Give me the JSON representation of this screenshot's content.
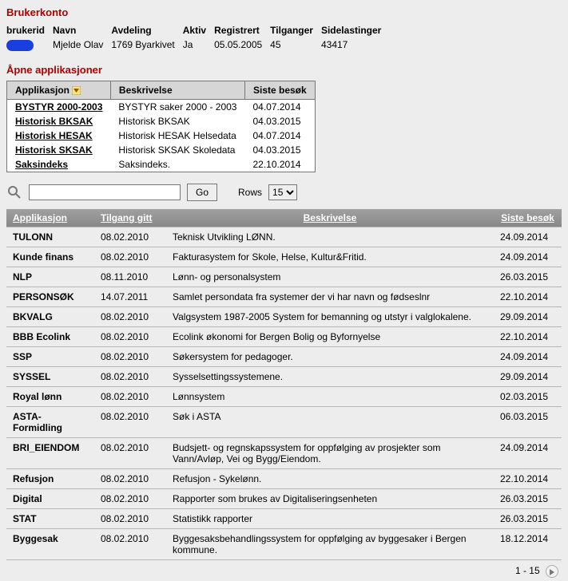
{
  "titles": {
    "user_account": "Brukerkonto",
    "open_apps": "Åpne applikasjoner"
  },
  "user_headers": {
    "brukerid": "brukerid",
    "navn": "Navn",
    "avdeling": "Avdeling",
    "aktiv": "Aktiv",
    "registrert": "Registrert",
    "tilganger": "Tilganger",
    "sidelastinger": "Sidelastinger"
  },
  "user": {
    "navn": "Mjelde Olav",
    "avdeling": "1769 Byarkivet",
    "aktiv": "Ja",
    "registrert": "05.05.2005",
    "tilganger": "45",
    "sidelastinger": "43417"
  },
  "open_apps_headers": {
    "applikasjon": "Applikasjon",
    "beskrivelse": "Beskrivelse",
    "siste_besok": "Siste besøk"
  },
  "open_apps": [
    {
      "app": "BYSTYR 2000-2003",
      "desc": "BYSTYR saker 2000 - 2003",
      "date": "04.07.2014"
    },
    {
      "app": "Historisk BKSAK",
      "desc": "Historisk BKSAK",
      "date": "04.03.2015"
    },
    {
      "app": "Historisk HESAK",
      "desc": "Historisk HESAK Helsedata",
      "date": "04.07.2014"
    },
    {
      "app": "Historisk SKSAK",
      "desc": "Historisk SKSAK Skoledata",
      "date": "04.03.2015"
    },
    {
      "app": "Saksindeks",
      "desc": "Saksindeks.",
      "date": "22.10.2014"
    }
  ],
  "search": {
    "go": "Go",
    "rows_label": "Rows",
    "rows_value": "15",
    "value": ""
  },
  "grid_headers": {
    "applikasjon": "Applikasjon",
    "tilgang_gitt": "Tilgang gitt",
    "beskrivelse": "Beskrivelse",
    "siste_besok": "Siste besøk"
  },
  "grid": [
    {
      "app": "TULONN",
      "tilgang": "08.02.2010",
      "desc": "Teknisk Utvikling LØNN.",
      "besok": "24.09.2014"
    },
    {
      "app": "Kunde finans",
      "tilgang": "08.02.2010",
      "desc": "Fakturasystem for Skole, Helse, Kultur&Fritid.",
      "besok": "24.09.2014"
    },
    {
      "app": "NLP",
      "tilgang": "08.11.2010",
      "desc": "Lønn- og personalsystem",
      "besok": "26.03.2015"
    },
    {
      "app": "PERSONSØK",
      "tilgang": "14.07.2011",
      "desc": "Samlet persondata fra systemer der vi har navn og fødseslnr",
      "besok": "22.10.2014"
    },
    {
      "app": "BKVALG",
      "tilgang": "08.02.2010",
      "desc": "Valgsystem 1987-2005 System for bemanning og utstyr i valglokalene.",
      "besok": "29.09.2014"
    },
    {
      "app": "BBB Ecolink",
      "tilgang": "08.02.2010",
      "desc": "Ecolink økonomi for Bergen Bolig og Byfornyelse",
      "besok": "22.10.2014"
    },
    {
      "app": "SSP",
      "tilgang": "08.02.2010",
      "desc": "Søkersystem for pedagoger.",
      "besok": "24.09.2014"
    },
    {
      "app": "SYSSEL",
      "tilgang": "08.02.2010",
      "desc": "Sysselsettingssystemene.",
      "besok": "29.09.2014"
    },
    {
      "app": "Royal lønn",
      "tilgang": "08.02.2010",
      "desc": "Lønnsystem",
      "besok": "02.03.2015"
    },
    {
      "app": "ASTA-Formidling",
      "tilgang": "08.02.2010",
      "desc": "Søk i ASTA",
      "besok": "06.03.2015"
    },
    {
      "app": "BRI_EIENDOM",
      "tilgang": "08.02.2010",
      "desc": "Budsjett- og regnskapssystem for oppfølging av prosjekter som Vann/Avløp, Vei og Bygg/Eiendom.",
      "besok": "24.09.2014"
    },
    {
      "app": "Refusjon",
      "tilgang": "08.02.2010",
      "desc": "Refusjon - Sykelønn.",
      "besok": "22.10.2014"
    },
    {
      "app": "Digital",
      "tilgang": "08.02.2010",
      "desc": "Rapporter som brukes av Digitaliseringsenheten",
      "besok": "26.03.2015"
    },
    {
      "app": "STAT",
      "tilgang": "08.02.2010",
      "desc": "Statistikk rapporter",
      "besok": "26.03.2015"
    },
    {
      "app": "Byggesak",
      "tilgang": "08.02.2010",
      "desc": "Byggesaksbehandlingssystem for oppfølging av byggesaker i Bergen kommune.",
      "besok": "18.12.2014"
    }
  ],
  "pager": {
    "text": "1 - 15"
  }
}
